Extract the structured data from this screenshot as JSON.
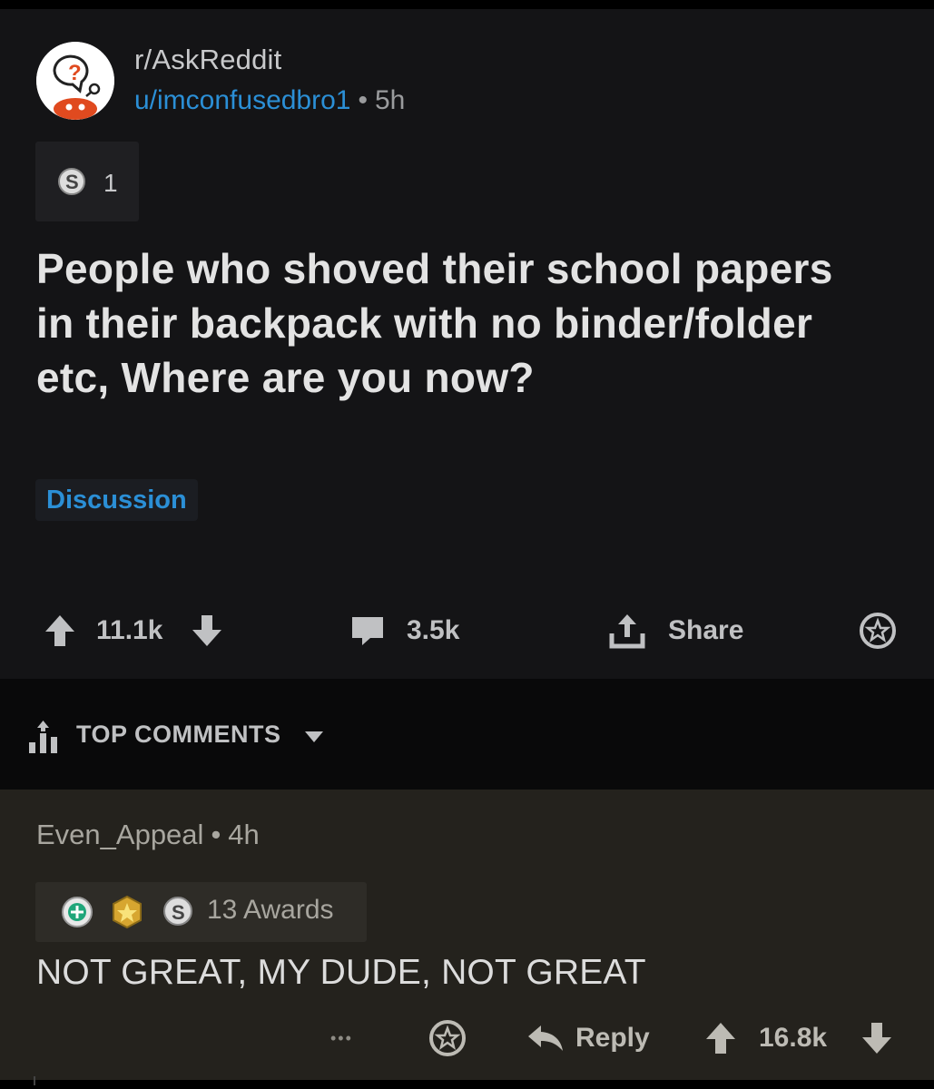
{
  "post": {
    "subreddit": "r/AskReddit",
    "author": "u/imconfusedbro1",
    "separator": "•",
    "age": "5h",
    "award_count": "1",
    "title": "People who shoved their school papers in their backpack with no binder/folder etc, Where are you now?",
    "flair": "Discussion",
    "upvotes": "11.1k",
    "comments": "3.5k",
    "share_label": "Share"
  },
  "sort": {
    "label": "TOP COMMENTS"
  },
  "comment": {
    "author": "Even_Appeal",
    "separator": "•",
    "age": "4h",
    "awards_label": "13 Awards",
    "body": "NOT GREAT, MY DUDE, NOT GREAT",
    "reply_label": "Reply",
    "upvotes": "16.8k",
    "more_glyph": "•••"
  },
  "colors": {
    "post_bg": "#141416",
    "comment_bg": "#24221d",
    "link_blue": "#2b8fd6",
    "text": "#d7dadc"
  },
  "icons": [
    "askreddit-avatar-icon",
    "silver-award-icon",
    "upvote-icon",
    "downvote-icon",
    "comment-icon",
    "share-icon",
    "award-icon",
    "sort-icon",
    "caret-down-icon",
    "helpful-award-icon",
    "gold-award-icon",
    "reply-icon",
    "more-icon"
  ]
}
